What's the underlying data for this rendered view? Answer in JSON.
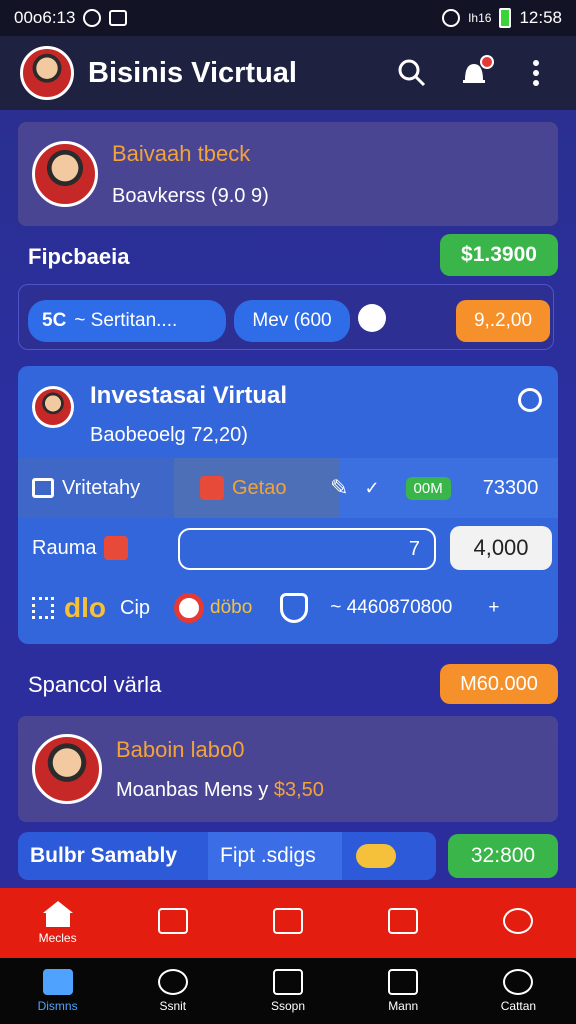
{
  "status_bar": {
    "time_left": "00o6:13",
    "time_right": "12:58",
    "signal_text": "Ih16"
  },
  "app": {
    "title": "Bisinis Vicrtual"
  },
  "profile": {
    "name": "Baivaah tbeck",
    "subtitle": "Boavkerss (9.0 9)"
  },
  "section1": {
    "label": "Fipcbaeia",
    "amount": "$1.3900"
  },
  "row": {
    "pill1_prefix": "5C",
    "pill1_text": "~ Sertitan....",
    "pill2_text": "Mev (600",
    "amount": "9,.2,00"
  },
  "invest": {
    "title": "Investasai Virtual",
    "subtitle": "Baobeoelg 72,20)",
    "row1": {
      "cell1": "Vritetahy",
      "cell2": "Getao",
      "badge": "00M",
      "value": "73300"
    },
    "row2": {
      "label": "Rauma",
      "input_value": "7",
      "amount": "4,000"
    },
    "row3": {
      "a": "dlo",
      "b": "Cip",
      "c": "döbo",
      "d": "~ 4460870800",
      "e": "+"
    }
  },
  "section2": {
    "label": "Spancol värla",
    "amount": "M60.000"
  },
  "person": {
    "name": "Baboin labo0",
    "subtitle_a": "Moanbas Mens y",
    "subtitle_b": "$3,50"
  },
  "bottom": {
    "left": "Bulbr Samably",
    "pill": "Fipt .sdigs",
    "amount": "32:800"
  },
  "red_nav": [
    {
      "label": "Mecles"
    },
    {
      "label": ""
    },
    {
      "label": ""
    },
    {
      "label": ""
    },
    {
      "label": ""
    }
  ],
  "black_nav": [
    {
      "label": "Dismns"
    },
    {
      "label": "Ssnit"
    },
    {
      "label": "Ssopn"
    },
    {
      "label": "Mann"
    },
    {
      "label": "Cattan"
    }
  ]
}
